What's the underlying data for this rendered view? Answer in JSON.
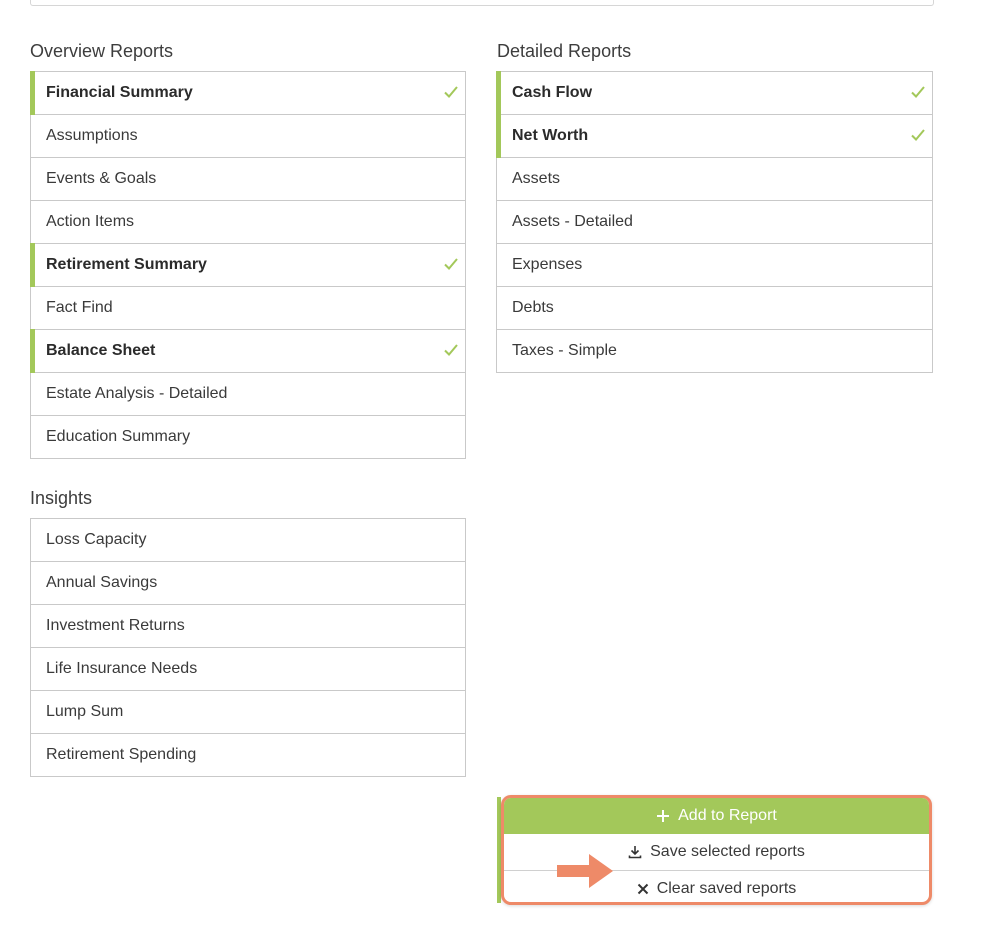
{
  "overview": {
    "title": "Overview Reports",
    "items": [
      {
        "label": "Financial Summary",
        "selected": true
      },
      {
        "label": "Assumptions",
        "selected": false
      },
      {
        "label": "Events & Goals",
        "selected": false
      },
      {
        "label": "Action Items",
        "selected": false
      },
      {
        "label": "Retirement Summary",
        "selected": true
      },
      {
        "label": "Fact Find",
        "selected": false
      },
      {
        "label": "Balance Sheet",
        "selected": true
      },
      {
        "label": "Estate Analysis - Detailed",
        "selected": false
      },
      {
        "label": "Education Summary",
        "selected": false
      }
    ]
  },
  "detailed": {
    "title": "Detailed Reports",
    "items": [
      {
        "label": "Cash Flow",
        "selected": true
      },
      {
        "label": "Net Worth",
        "selected": true
      },
      {
        "label": "Assets",
        "selected": false
      },
      {
        "label": "Assets - Detailed",
        "selected": false
      },
      {
        "label": "Expenses",
        "selected": false
      },
      {
        "label": "Debts",
        "selected": false
      },
      {
        "label": "Taxes - Simple",
        "selected": false
      }
    ]
  },
  "insights": {
    "title": "Insights",
    "items": [
      {
        "label": "Loss Capacity",
        "selected": false
      },
      {
        "label": "Annual Savings",
        "selected": false
      },
      {
        "label": "Investment Returns",
        "selected": false
      },
      {
        "label": "Life Insurance Needs",
        "selected": false
      },
      {
        "label": "Lump Sum",
        "selected": false
      },
      {
        "label": "Retirement Spending",
        "selected": false
      }
    ]
  },
  "actions": {
    "add_label": "Add to Report",
    "save_label": "Save selected reports",
    "clear_label": "Clear saved reports"
  },
  "colors": {
    "accent_green": "#a3c85a",
    "highlight_orange": "#ee8a68"
  },
  "icons": {
    "add": "plus-icon",
    "save": "download-icon",
    "clear": "close-icon",
    "selected": "checkmark-icon"
  }
}
